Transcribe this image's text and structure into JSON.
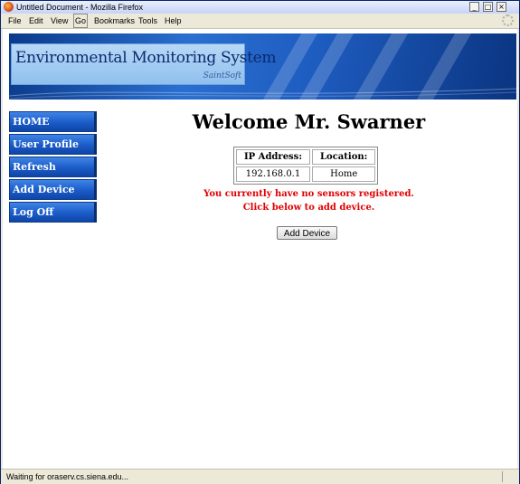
{
  "window": {
    "title": "Untitled Document - Mozilla Firefox",
    "controls": [
      "minimize",
      "maximize",
      "close"
    ]
  },
  "menubar": {
    "items": [
      "File",
      "Edit",
      "View",
      "Go",
      "Bookmarks",
      "Tools",
      "Help"
    ]
  },
  "banner": {
    "title": "Environmental Monitoring System",
    "subtitle": "SaintSoft"
  },
  "nav": {
    "items": [
      "HOME",
      "User Profile",
      "Refresh",
      "Add Device",
      "Log Off"
    ]
  },
  "main": {
    "welcome": "Welcome Mr. Swarner",
    "info": {
      "ip_label": "IP Address:",
      "ip_value": "192.168.0.1",
      "location_label": "Location:",
      "location_value": "Home"
    },
    "message_line1": "You currently have no sensors registered.",
    "message_line2": "Click below to add device.",
    "add_button": "Add Device"
  },
  "status": {
    "text": "Waiting for oraserv.cs.siena.edu..."
  },
  "colors": {
    "nav_blue": "#1a5bc8",
    "message_red": "#e00000",
    "banner_blue": "#2a6fd0"
  }
}
